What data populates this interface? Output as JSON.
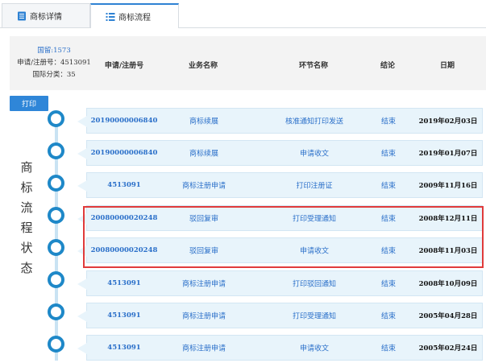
{
  "tabs": [
    {
      "label": "商标详情",
      "icon": "document-icon"
    },
    {
      "label": "商标流程",
      "icon": "list-icon"
    }
  ],
  "info": {
    "status_link": "国留:1573",
    "reg_line": "申请/注册号：4513091",
    "class_line": "国际分类：35"
  },
  "columns": [
    "申请/注册号",
    "业务名称",
    "环节名称",
    "结论",
    "日期"
  ],
  "print_label": "打印",
  "side_title": [
    "商",
    "标",
    "流",
    "程",
    "状",
    "态"
  ],
  "rows": [
    {
      "num": "20190000006840",
      "biz": "商标续展",
      "step": "核准通知打印发送",
      "result": "结束",
      "date": "2019年02月03日"
    },
    {
      "num": "20190000006840",
      "biz": "商标续展",
      "step": "申请收文",
      "result": "结束",
      "date": "2019年01月07日"
    },
    {
      "num": "4513091",
      "biz": "商标注册申请",
      "step": "打印注册证",
      "result": "结束",
      "date": "2009年11月16日"
    },
    {
      "num": "20080000020248",
      "biz": "驳回复审",
      "step": "打印受理通知",
      "result": "结束",
      "date": "2008年12月11日"
    },
    {
      "num": "20080000020248",
      "biz": "驳回复审",
      "step": "申请收文",
      "result": "结束",
      "date": "2008年11月03日"
    },
    {
      "num": "4513091",
      "biz": "商标注册申请",
      "step": "打印驳回通知",
      "result": "结束",
      "date": "2008年10月09日"
    },
    {
      "num": "4513091",
      "biz": "商标注册申请",
      "step": "打印受理通知",
      "result": "结束",
      "date": "2005年04月28日"
    },
    {
      "num": "4513091",
      "biz": "商标注册申请",
      "step": "申请收文",
      "result": "结束",
      "date": "2005年02月24日"
    }
  ]
}
